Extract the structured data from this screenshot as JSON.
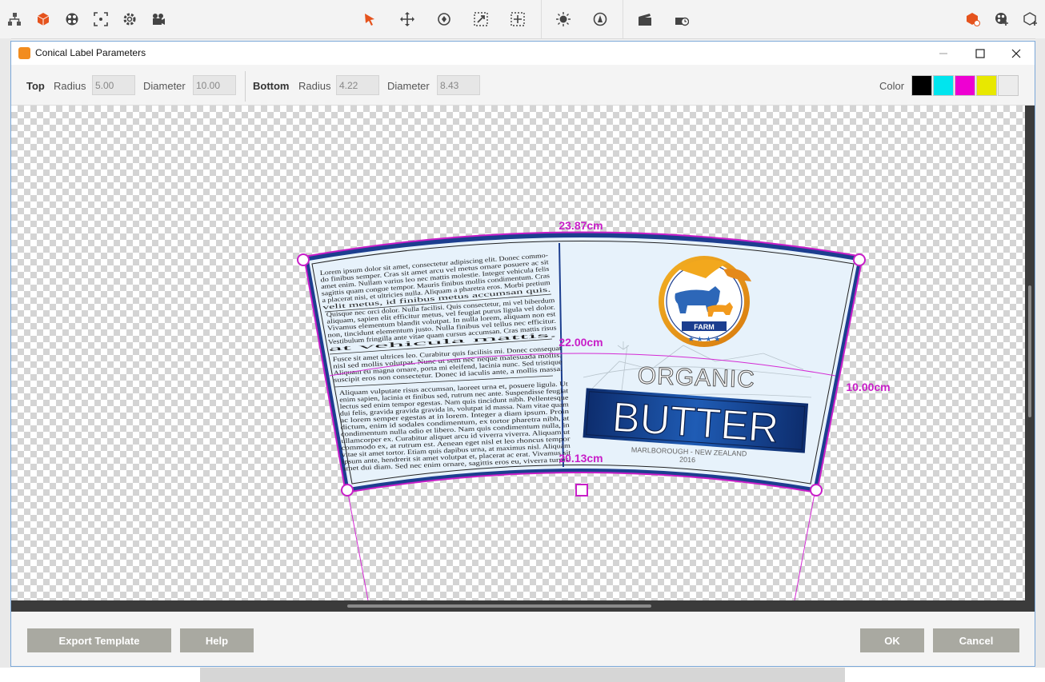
{
  "toolbar": {
    "left_icons": [
      "hierarchy-icon",
      "cube-icon",
      "materials-icon",
      "focus-icon",
      "settings-icon",
      "camera-icon"
    ],
    "center_icons": [
      "select-arrow-icon",
      "move-icon",
      "rotate-icon",
      "scale-icon",
      "pivot-icon"
    ],
    "right_icons": [
      "light-icon",
      "environment-icon",
      "animation-icon",
      "render-clip-icon",
      "add-part-icon",
      "add-material-icon",
      "add-model-icon"
    ]
  },
  "dialog": {
    "title": "Conical Label Parameters",
    "top_label": "Top",
    "top_radius_label": "Radius",
    "top_radius": "5.00",
    "top_diameter_label": "Diameter",
    "top_diameter": "10.00",
    "bottom_label": "Bottom",
    "bottom_radius_label": "Radius",
    "bottom_radius": "4.22",
    "bottom_diameter_label": "Diameter",
    "bottom_diameter": "8.43",
    "color_label": "Color",
    "colors": [
      "#000000",
      "#00e5ee",
      "#ee00d2",
      "#e8e800",
      "#ececec"
    ]
  },
  "canvas": {
    "dim_top": "23.87cm",
    "dim_middle": "22.00cm",
    "dim_bottom": "20.13cm",
    "dim_height": "10.00cm"
  },
  "label": {
    "badge_text": "FARM",
    "organic": "ORGANIC",
    "butter": "BUTTER",
    "origin": "MARLBOROUGH - NEW ZEALAND",
    "year": "2016",
    "para1": [
      "Lorem ipsum dolor sit amet, consectetur adipiscing elit. Donec commo-",
      "do finibus semper. Cras sit amet arcu vel metus ornare posuere ac sit",
      "amet enim. Nullam varius leo nec mattis molestie. Integer vehicula felis",
      "sagittis quam congue tempor. Mauris finibus mollis condimentum. Cras",
      "a placerat nisi, et ultricies nulla. Aliquam a pharetra eros. Morbi pretium",
      "velit metus, id finibus metus accumsan quis."
    ],
    "para2": [
      "Quisque nec orci dolor. Nulla facilisi. Quis consectetur, mi vel biberdum",
      "aliquam, sapien elit efficitur metus, vel feugiat purus ligula vel dolor.",
      "Vivamus elementum blandit volutpat. In nulla lorem, aliquam non est",
      "non, tincidunt elementum justo. Nulla finibus vel tellus nec efficitur.",
      "Vestibulum fringilla ante vitae quam cursus accumsan. Cras mattis risus",
      "at vehicula mattis."
    ],
    "para3": [
      "Fusce sit amet ultrices leo. Curabitur quis facilisis mi. Donec consequat",
      "nisl sed mollis volutpat. Nunc ut sem nec neque malesuada mollis.",
      "Aliquam eu magna ornare, porta mi eleifend, lacinia nunc. Sed tristique",
      "suscipit eros non consectetur. Donec id iaculis ante, a mollis massa."
    ],
    "para4": [
      "Aliquam vulputate risus accumsan, laoreet urna et, posuere ligula. Ut",
      "enim sapien, lacinia et finibus sed, rutrum nec ante. Suspendisse feugiat",
      "lectus sed enim tempor egestas. Nam quis tincidunt nibh. Pellentesque",
      "dui felis, gravida gravida gravida in, volutpat id massa. Nam vitae quam",
      "ac lorem semper egestas at in lorem. Integer a diam ipsum. Proin",
      "dictum, enim id sodales condimentum, ex tortor pharetra nibh, at",
      "condimentum nulla odio et libero. Nam quis condimentum nulla, in",
      "ullamcorper ex. Curabitur aliquet arcu id viverra viverra. Aliquam ut",
      "commodo ex, at rutrum est. Aenean eget nisl et leo rhoncus tempor",
      "vitae sit amet tortor. Etiam quis dapibus urna, at maximus nisl. Aliquam",
      "ipsum ante, hendrerit sit amet volutpat et, placerat ac erat. Vivamus sit",
      "amet dui diam. Sed nec enim ornare, sagittis eros eu, viverra turpis."
    ]
  },
  "footer": {
    "export_template": "Export Template",
    "help": "Help",
    "ok": "OK",
    "cancel": "Cancel"
  }
}
